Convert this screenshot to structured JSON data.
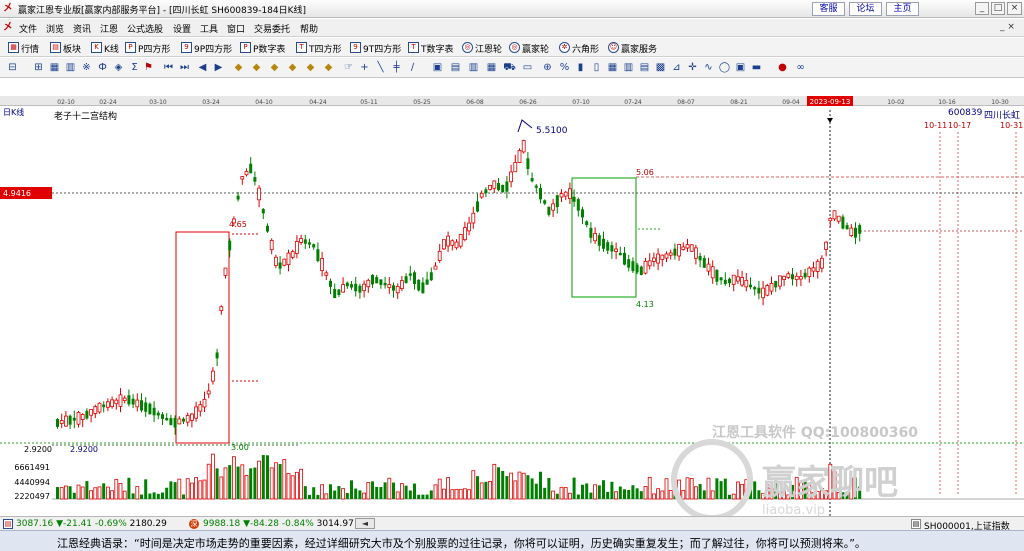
{
  "window": {
    "title": "赢家江恩专业版[赢家内部服务平台] - [四川长虹  SH600839-184日K线]",
    "links": [
      "客服",
      "论坛",
      "主页"
    ]
  },
  "menu": [
    "文件",
    "浏览",
    "资讯",
    "江恩",
    "公式选股",
    "设置",
    "工具",
    "窗口",
    "交易委托",
    "帮助"
  ],
  "viewbar": [
    {
      "icon": "quotes-icon",
      "label": "行情"
    },
    {
      "icon": "blocks-icon",
      "label": "板块"
    },
    {
      "icon": "kline-icon",
      "label": "K线"
    },
    {
      "icon": "p-square-icon",
      "label": "P四方形"
    },
    {
      "icon": "9p-square-icon",
      "label": "9P四方形"
    },
    {
      "icon": "p-number-table-icon",
      "label": "P数字表"
    },
    {
      "icon": "t-square-icon",
      "label": "T四方形"
    },
    {
      "icon": "9t-square-icon",
      "label": "9T四方形"
    },
    {
      "icon": "t-number-table-icon",
      "label": "T数字表"
    },
    {
      "icon": "gann-wheel-icon",
      "label": "江恩轮"
    },
    {
      "icon": "winner-wheel-icon",
      "label": "赢家轮"
    },
    {
      "icon": "hexagon-icon",
      "label": "六角形"
    },
    {
      "icon": "service-icon",
      "label": "赢家服务"
    }
  ],
  "chart_header": {
    "period_label": "日K线",
    "date_ticks": [
      "02-10",
      "02-24",
      "03-10",
      "03-24",
      "04-10",
      "04-24",
      "05-11",
      "05-25",
      "06-08",
      "06-26",
      "07-10",
      "07-24",
      "08-07",
      "08-21",
      "09-04",
      "2023-09-13",
      "10-02",
      "10-16",
      "10-30"
    ],
    "highlight_date": "2023-09-13",
    "structure_title": "老子十二宫结构",
    "stock_code": "600839",
    "stock_name": "四川长虹",
    "future_dates": [
      "10-11",
      "10-17",
      "10-31"
    ]
  },
  "chart_data": {
    "type": "candlestick",
    "current_price_label": "4.9416",
    "y_axis_labels": [
      "6661491",
      "4440994",
      "2220497"
    ],
    "annotations": [
      "5.5100",
      "5.06",
      "4.65",
      "4.13",
      "3.00",
      "2.9200",
      "2.9200"
    ],
    "watermark": [
      "江恩工具软件  QQ:100800360",
      "赢家聊吧"
    ],
    "watermark_url": "liaoba.vip"
  },
  "status": {
    "sh_index": "3087.16",
    "sh_change": "▼-21.41",
    "sh_pct": "-0.69%",
    "sh_amount": "2180.29",
    "sz_index": "9988.18",
    "sz_change": "▼-84.28",
    "sz_pct": "-0.84%",
    "sz_amount": "3014.97",
    "right_info": "SH000001,上证指数"
  },
  "quote": "江恩经典语录：“时间是决定市场走势的重要因素，经过详细研究大市及个别股票的过往记录，你将可以证明，历史确实重复发生；而了解过往，你将可以预测将来。”。"
}
